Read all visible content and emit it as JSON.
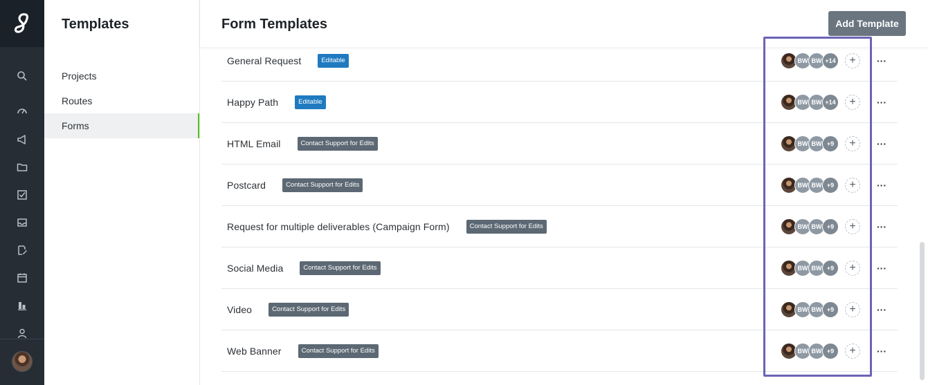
{
  "rail": {
    "icons": [
      "search-icon",
      "dashboard-icon",
      "megaphone-icon",
      "folder-icon",
      "checkbox-icon",
      "inbox-icon",
      "edit-document-icon",
      "calendar-icon",
      "chart-icon",
      "user-icon"
    ]
  },
  "sidebar": {
    "title": "Templates",
    "items": [
      {
        "label": "Projects",
        "active": false
      },
      {
        "label": "Routes",
        "active": false
      },
      {
        "label": "Forms",
        "active": true
      }
    ]
  },
  "header": {
    "title": "Form Templates",
    "add_button": "Add Template"
  },
  "templates": [
    {
      "name": "General Request",
      "badge": "Editable",
      "badge_type": "editable",
      "avatar_initials": [
        "BW",
        "BW"
      ],
      "more_count": "+14"
    },
    {
      "name": "Happy Path",
      "badge": "Editable",
      "badge_type": "editable",
      "avatar_initials": [
        "BW",
        "BW"
      ],
      "more_count": "+14"
    },
    {
      "name": "HTML Email",
      "badge": "Contact Support for Edits",
      "badge_type": "support",
      "avatar_initials": [
        "BW",
        "BW"
      ],
      "more_count": "+9"
    },
    {
      "name": "Postcard",
      "badge": "Contact Support for Edits",
      "badge_type": "support",
      "avatar_initials": [
        "BW",
        "BW"
      ],
      "more_count": "+9"
    },
    {
      "name": "Request for multiple deliverables (Campaign Form)",
      "badge": "Contact Support for Edits",
      "badge_type": "support",
      "avatar_initials": [
        "BW",
        "BW"
      ],
      "more_count": "+9"
    },
    {
      "name": "Social Media",
      "badge": "Contact Support for Edits",
      "badge_type": "support",
      "avatar_initials": [
        "BW",
        "BW"
      ],
      "more_count": "+9"
    },
    {
      "name": "Video",
      "badge": "Contact Support for Edits",
      "badge_type": "support",
      "avatar_initials": [
        "BW",
        "BW"
      ],
      "more_count": "+9"
    },
    {
      "name": "Web Banner",
      "badge": "Contact Support for Edits",
      "badge_type": "support",
      "avatar_initials": [
        "BW",
        "BW"
      ],
      "more_count": "+9"
    }
  ],
  "colors": {
    "rail_bg": "#262d35",
    "editable_badge": "#1f7ac0",
    "support_badge": "#5c6873",
    "active_indicator": "#52c41a",
    "highlight_box": "#6b63b5"
  },
  "row_labels": {
    "add_assignee_glyph": "+",
    "more_glyph": "···"
  }
}
